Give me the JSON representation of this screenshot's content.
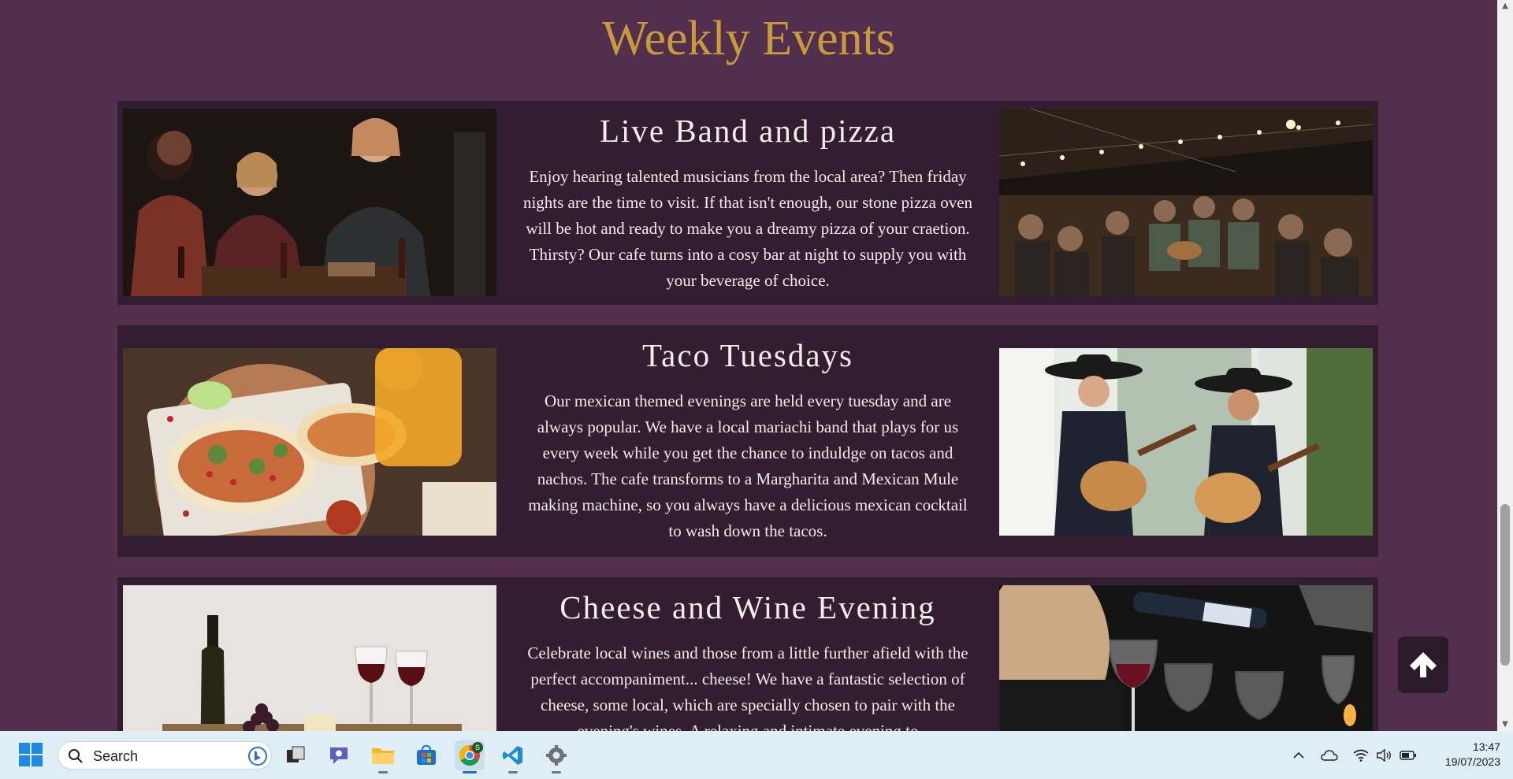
{
  "section": {
    "title": "Weekly Events"
  },
  "events": [
    {
      "title": "Live Band and pizza",
      "description": "Enjoy hearing talented musicians from the local area? Then friday nights are the time to visit. If that isn't enough, our stone pizza oven will be hot and ready to make you a dreamy pizza of your craetion. Thirsty? Our cafe turns into a cosy bar at night to supply you with your beverage of choice."
    },
    {
      "title": "Taco Tuesdays",
      "description": "Our mexican themed evenings are held every tuesday and are always popular. We have a local mariachi band that plays for us every week while you get the chance to induldge on tacos and nachos. The cafe transforms to a Margharita and Mexican Mule making machine, so you always have a delicious mexican cocktail to wash down the tacos."
    },
    {
      "title": "Cheese and Wine Evening",
      "description": "Celebrate local wines and those from a little further afield with the perfect accompaniment... cheese! We have a fantastic selection of cheese, some local, which are specially chosen to pair with the evening's wines. A relaxing and intimate evening to"
    }
  ],
  "taskbar": {
    "search_placeholder": "Search",
    "time": "13:47",
    "date": "19/07/2023",
    "chrome_badge": "S"
  },
  "icons": {
    "back_to_top": "arrow-up-icon",
    "start": "windows-start-icon"
  },
  "colors": {
    "page_background": "#52304d",
    "card_background": "#331d31",
    "heading_gold": "#c89a3c",
    "taskbar": "#dfeef5"
  }
}
